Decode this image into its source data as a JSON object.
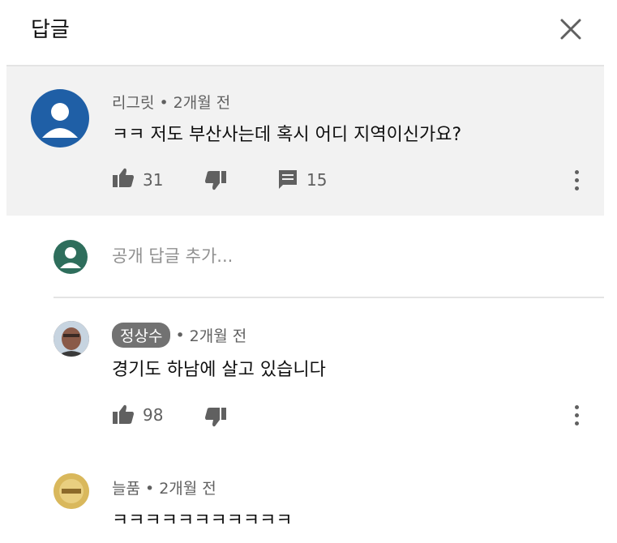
{
  "header": {
    "title": "답글"
  },
  "parent_comment": {
    "author": "리그릿",
    "time": "2개월 전",
    "text": "ㅋㅋ 저도 부산사는데 혹시 어디 지역이신가요?",
    "likes": "31",
    "replies": "15"
  },
  "add_reply": {
    "placeholder": "공개 답글 추가..."
  },
  "replies": [
    {
      "author": "정상수",
      "time": "2개월 전",
      "text": "경기도 하남에 살고 있습니다",
      "likes": "98"
    },
    {
      "author": "늘품",
      "time": "2개월 전",
      "text": "ㅋㅋㅋㅋㅋㅋㅋㅋㅋㅋㅋ"
    }
  ],
  "separator": "•",
  "colors": {
    "parent_bg": "#f2f2f2",
    "badge_bg": "#727272",
    "avatar_blue": "#1f5fa6"
  }
}
